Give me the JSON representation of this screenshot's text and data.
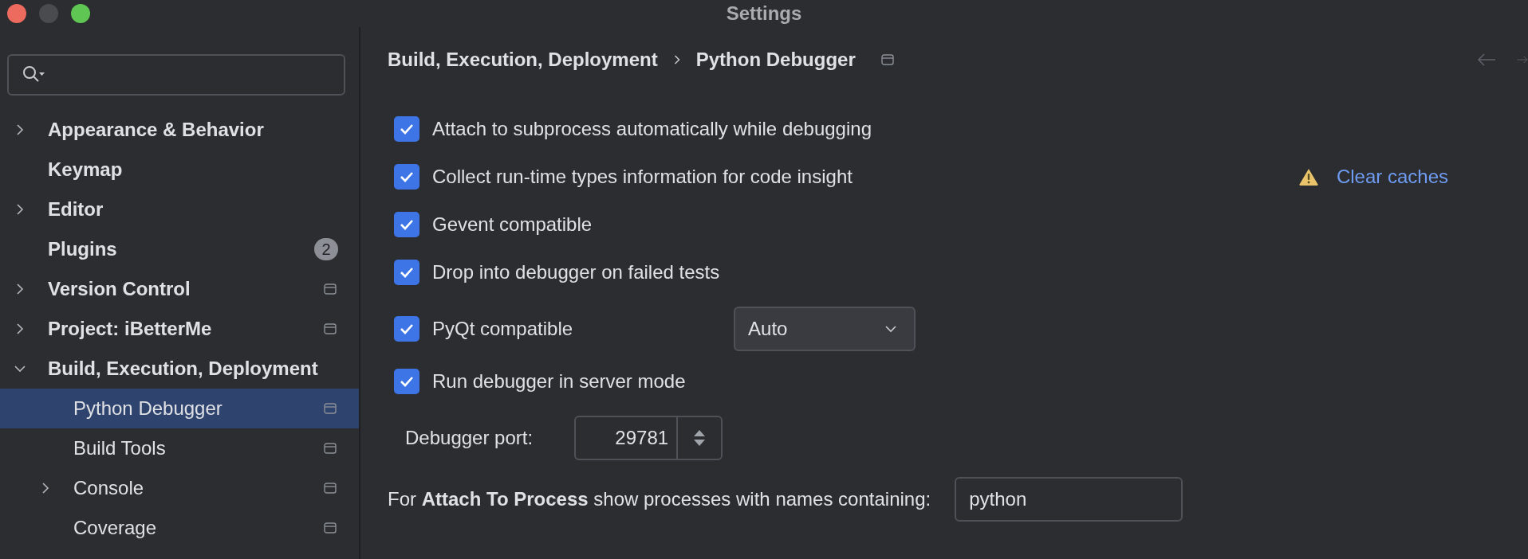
{
  "window": {
    "title": "Settings"
  },
  "sidebar": {
    "items": [
      {
        "label": "Appearance & Behavior",
        "expandable": true,
        "expanded": false,
        "selected": false,
        "scope_icon": false
      },
      {
        "label": "Keymap",
        "expandable": false,
        "selected": false,
        "scope_icon": false
      },
      {
        "label": "Editor",
        "expandable": true,
        "expanded": false,
        "selected": false,
        "scope_icon": false
      },
      {
        "label": "Plugins",
        "expandable": false,
        "selected": false,
        "scope_icon": false,
        "badge": "2"
      },
      {
        "label": "Version Control",
        "expandable": true,
        "expanded": false,
        "selected": false,
        "scope_icon": true
      },
      {
        "label": "Project: iBetterMe",
        "expandable": true,
        "expanded": false,
        "selected": false,
        "scope_icon": true
      },
      {
        "label": "Build, Execution, Deployment",
        "expandable": true,
        "expanded": true,
        "selected": false,
        "scope_icon": false,
        "children": [
          {
            "label": "Python Debugger",
            "expandable": false,
            "selected": true,
            "scope_icon": true
          },
          {
            "label": "Build Tools",
            "expandable": false,
            "selected": false,
            "scope_icon": true
          },
          {
            "label": "Console",
            "expandable": true,
            "expanded": false,
            "selected": false,
            "scope_icon": true
          },
          {
            "label": "Coverage",
            "expandable": false,
            "selected": false,
            "scope_icon": true
          }
        ]
      }
    ]
  },
  "breadcrumb": [
    "Build, Execution, Deployment",
    "Python Debugger"
  ],
  "options": [
    {
      "kind": "checkbox",
      "label": "Attach to subprocess automatically while debugging",
      "checked": true
    },
    {
      "kind": "checkbox",
      "label": "Collect run-time types information for code insight",
      "checked": true,
      "link": "Clear caches"
    },
    {
      "kind": "checkbox",
      "label": "Gevent compatible",
      "checked": true
    },
    {
      "kind": "checkbox",
      "label": "Drop into debugger on failed tests",
      "checked": true
    },
    {
      "kind": "checkbox",
      "label": "PyQt compatible",
      "checked": true,
      "dropdown": "Auto"
    },
    {
      "kind": "checkbox",
      "label": "Run debugger in server mode",
      "checked": true
    },
    {
      "kind": "spinner",
      "label": "Debugger port:",
      "value": "29781"
    },
    {
      "kind": "textfield",
      "label": "For **Attach To Process** show processes with names containing:",
      "value": "python"
    }
  ]
}
